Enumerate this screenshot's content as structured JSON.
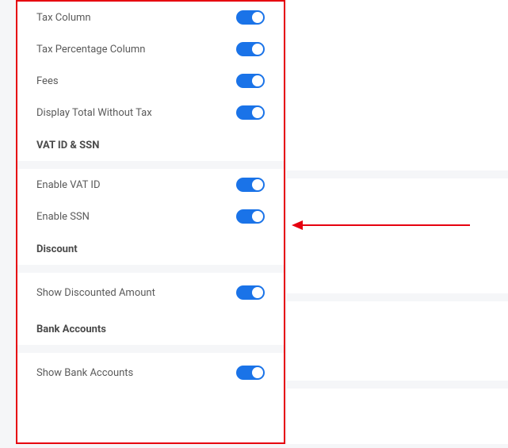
{
  "settings": {
    "taxColumn": {
      "label": "Tax Column",
      "value": true
    },
    "taxPercentageColumn": {
      "label": "Tax Percentage Column",
      "value": true
    },
    "fees": {
      "label": "Fees",
      "value": true
    },
    "displayTotalWithoutTax": {
      "label": "Display Total Without Tax",
      "value": true
    },
    "enableVatId": {
      "label": "Enable VAT ID",
      "value": true
    },
    "enableSsn": {
      "label": "Enable SSN",
      "value": true
    },
    "showDiscountedAmount": {
      "label": "Show Discounted Amount",
      "value": true
    },
    "showBankAccounts": {
      "label": "Show Bank Accounts",
      "value": true
    }
  },
  "sections": {
    "vatIdSsn": "VAT ID & SSN",
    "discount": "Discount",
    "bankAccounts": "Bank Accounts"
  }
}
